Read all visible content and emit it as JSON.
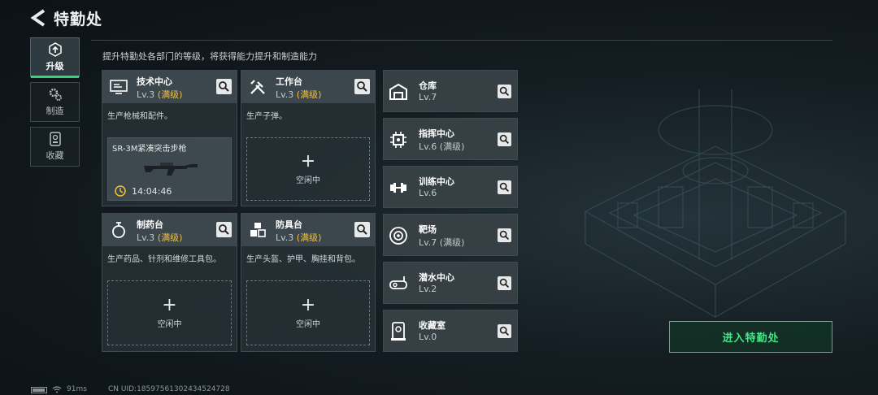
{
  "header": {
    "title": "特勤处"
  },
  "subtitle": "提升特勤处各部门的等级，将获得能力提升和制造能力",
  "tabs": [
    {
      "label": "升级",
      "icon": "upgrade-icon"
    },
    {
      "label": "制造",
      "icon": "gear-icon"
    },
    {
      "label": "收藏",
      "icon": "collection-icon"
    }
  ],
  "cards": [
    {
      "name": "技术中心",
      "level": "Lv.3",
      "max": "(满级)",
      "desc": "生产枪械和配件。",
      "icon": "tech-center-icon",
      "production": {
        "item": "SR-3M紧凑突击步枪",
        "time": "14:04:46"
      }
    },
    {
      "name": "工作台",
      "level": "Lv.3",
      "max": "(满级)",
      "desc": "生产子弹。",
      "icon": "workbench-icon",
      "idle": "空闲中"
    },
    {
      "name": "制药台",
      "level": "Lv.3",
      "max": "(满级)",
      "desc": "生产药品、针剂和维修工具包。",
      "icon": "pharmacy-icon",
      "idle": "空闲中"
    },
    {
      "name": "防具台",
      "level": "Lv.3",
      "max": "(满级)",
      "desc": "生产头盔、护甲、胸挂和背包。",
      "icon": "armor-bench-icon",
      "idle": "空闲中"
    }
  ],
  "small_cards": [
    {
      "name": "仓库",
      "level": "Lv.7",
      "max": "",
      "icon": "warehouse-icon"
    },
    {
      "name": "指挥中心",
      "level": "Lv.6",
      "max": "(满级)",
      "icon": "command-center-icon"
    },
    {
      "name": "训练中心",
      "level": "Lv.6",
      "max": "",
      "icon": "dumbbell-icon"
    },
    {
      "name": "靶场",
      "level": "Lv.7",
      "max": "(满级)",
      "icon": "target-icon"
    },
    {
      "name": "潜水中心",
      "level": "Lv.2",
      "max": "",
      "icon": "diving-mask-icon"
    },
    {
      "name": "收藏室",
      "level": "Lv.0",
      "max": "",
      "icon": "display-case-icon"
    }
  ],
  "enter_button": "进入特勤处",
  "footer": {
    "ping": "91ms",
    "uid": "CN UID:185975613024345247​28"
  },
  "colors": {
    "accent": "#36d27a",
    "max_level": "#f3c13a"
  }
}
